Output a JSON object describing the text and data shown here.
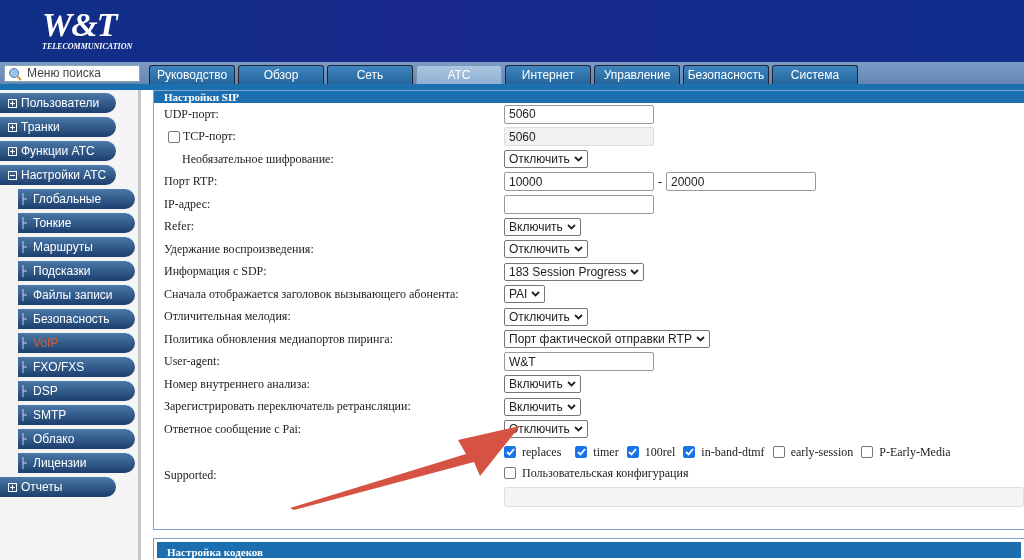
{
  "logo": {
    "title": "W&T",
    "subtitle": "TELECOMMUNICATION"
  },
  "search": {
    "placeholder": "Меню поиска"
  },
  "tabs": [
    {
      "label": "Руководство",
      "selected": false
    },
    {
      "label": "Обзор",
      "selected": false
    },
    {
      "label": "Сеть",
      "selected": false
    },
    {
      "label": "АТС",
      "selected": true
    },
    {
      "label": "Интернет",
      "selected": false
    },
    {
      "label": "Управление",
      "selected": false
    },
    {
      "label": "Безопасность",
      "selected": false
    },
    {
      "label": "Система",
      "selected": false
    }
  ],
  "sidebar": {
    "items": [
      {
        "label": "Пользователи",
        "expanded": false
      },
      {
        "label": "Транки",
        "expanded": false
      },
      {
        "label": "Функции АТС",
        "expanded": false
      },
      {
        "label": "Настройки АТС",
        "expanded": true,
        "children": [
          {
            "label": "Глобальные",
            "selected": false
          },
          {
            "label": "Тонкие",
            "selected": false
          },
          {
            "label": "Маршруты",
            "selected": false
          },
          {
            "label": "Подсказки",
            "selected": false
          },
          {
            "label": "Файлы записи",
            "selected": false
          },
          {
            "label": "Безопасность",
            "selected": false
          },
          {
            "label": "VoIP",
            "selected": true
          },
          {
            "label": "FXO/FXS",
            "selected": false
          },
          {
            "label": "DSP",
            "selected": false
          },
          {
            "label": "SMTP",
            "selected": false
          },
          {
            "label": "Облако",
            "selected": false
          },
          {
            "label": "Лицензии",
            "selected": false
          }
        ]
      },
      {
        "label": "Отчеты",
        "expanded": false
      }
    ]
  },
  "sections": [
    {
      "title": "Настройки SIP",
      "rows": [
        {
          "kind": "input",
          "label": "UDP-порт:",
          "value": "5060"
        },
        {
          "kind": "input",
          "label": "TCP-порт:",
          "checked": false,
          "disabled": true,
          "value": "5060",
          "children": [
            {
              "kind": "select",
              "label": "Необязательное шифрование:",
              "value": "Отключить"
            }
          ]
        },
        {
          "kind": "range",
          "label": "Порт RTP:",
          "values": [
            "10000",
            "20000"
          ],
          "separator": "-"
        },
        {
          "kind": "input",
          "label": "IP-адрес:"
        },
        {
          "kind": "select",
          "label": "Refer:",
          "value": "Включить"
        },
        {
          "kind": "select",
          "label": "Удержание воспроизведения:",
          "value": "Отключить"
        },
        {
          "kind": "select",
          "label": "Информация с SDP:",
          "value": "183 Session Progress"
        },
        {
          "kind": "select",
          "label": "Сначала отображается заголовок вызывающего абонента:",
          "value": "PAI"
        },
        {
          "kind": "select",
          "label": "Отличительная мелодия:",
          "value": "Отключить"
        },
        {
          "kind": "select",
          "label": "Политика обновления медиапортов пиринга:",
          "value": "Порт фактической отправки RTP"
        },
        {
          "kind": "input",
          "label": "User-agent:",
          "value": "W&T"
        },
        {
          "kind": "select",
          "label": "Номер внутреннего анализа:",
          "value": "Включить"
        },
        {
          "kind": "select",
          "label": "Зарегистрировать переключатель ретрансляции:",
          "value": "Включить"
        },
        {
          "kind": "select",
          "label": "Ответное сообщение с Pai:",
          "value": "Отключить"
        },
        {
          "kind": "options",
          "label": "Supported:",
          "options": [
            {
              "label": "replaces",
              "checked": true
            },
            {
              "label": "timer",
              "checked": true
            },
            {
              "label": "100rel",
              "checked": true
            },
            {
              "label": "in-band-dtmf",
              "checked": true
            },
            {
              "label": "early-session",
              "checked": false
            },
            {
              "label": "P-Early-Media",
              "checked": false
            }
          ],
          "custom": {
            "label": "Пользовательская конфигурация",
            "checked": false
          }
        }
      ]
    },
    {
      "title": "Настройка кодеков"
    }
  ]
}
